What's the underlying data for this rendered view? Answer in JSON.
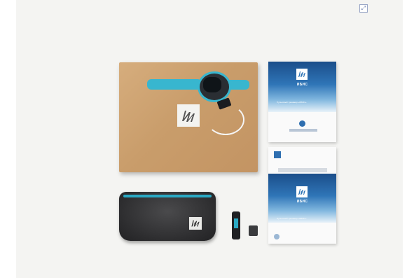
{
  "image": {
    "expand_icon": "expand-icon",
    "manuals": [
      {
        "title": "ИБИС",
        "subtitle": "Пульсовый тренажер «ИБИС»"
      },
      {
        "title": "ИБИС",
        "subtitle": "Пульсовый тренажер «ИБИС»"
      }
    ]
  },
  "colors": {
    "background": "#f4f4f2",
    "cardboard": "#c99d6b",
    "accent_blue": "#38b6cf",
    "manual_blue": "#2f75b7",
    "pouch": "#2d2d2f"
  }
}
